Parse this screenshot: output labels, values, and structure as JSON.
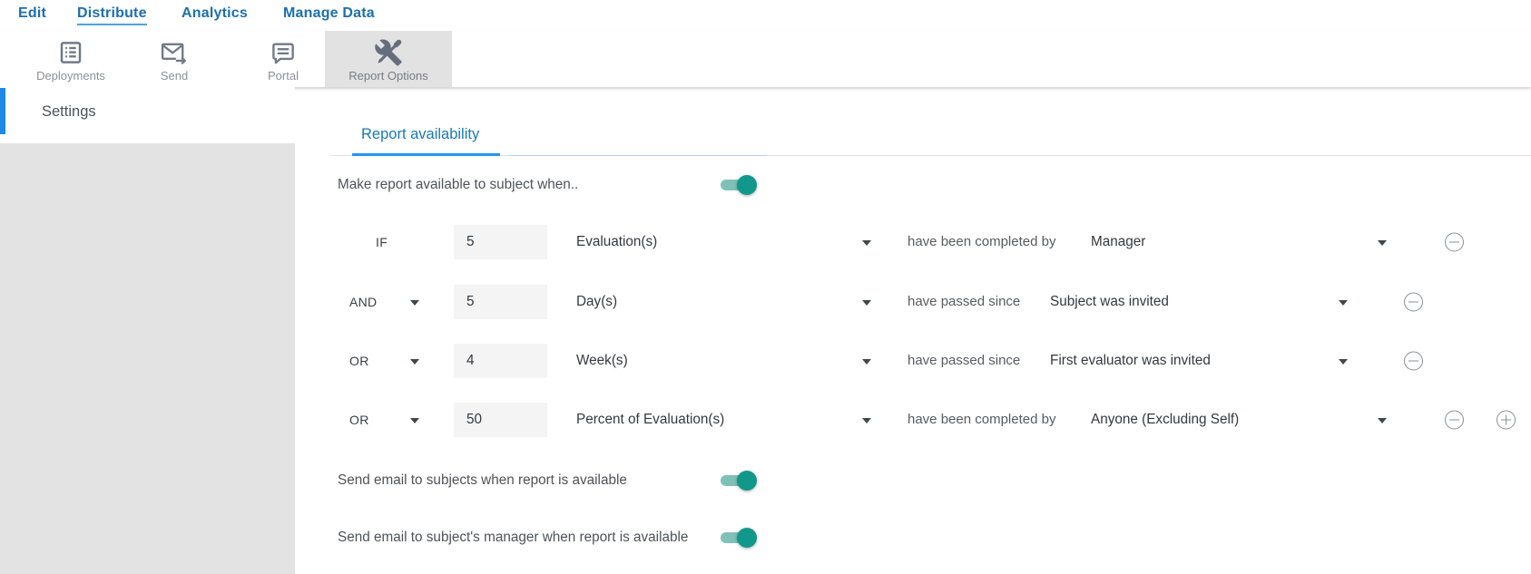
{
  "nav": {
    "items": [
      {
        "label": "Edit"
      },
      {
        "label": "Distribute",
        "active": true
      },
      {
        "label": "Analytics"
      },
      {
        "label": "Manage Data"
      }
    ]
  },
  "toolbar": {
    "items": [
      {
        "label": "Deployments",
        "icon": "list-icon"
      },
      {
        "label": "Send",
        "icon": "envelope-arrow-icon"
      },
      {
        "label": "Portal",
        "icon": "chat-bubble-icon"
      },
      {
        "label": "Report Options",
        "icon": "wrench-screwdriver-icon",
        "selected": true
      }
    ]
  },
  "sidebar": {
    "items": [
      {
        "label": "Settings",
        "active": true
      }
    ]
  },
  "main": {
    "tab": {
      "label": "Report availability",
      "active": true
    },
    "master_toggle": {
      "label": "Make report available to subject when..",
      "state": "on"
    },
    "conditions": [
      {
        "connector": "IF",
        "amount": "5",
        "unit": "Evaluation(s)",
        "verb": "have been completed by",
        "target": "Manager"
      },
      {
        "connector": "AND",
        "amount": "5",
        "unit": "Day(s)",
        "verb": "have passed since",
        "target": "Subject was invited"
      },
      {
        "connector": "OR",
        "amount": "4",
        "unit": "Week(s)",
        "verb": "have passed since",
        "target": "First evaluator was invited"
      },
      {
        "connector": "OR",
        "amount": "50",
        "unit": "Percent of Evaluation(s)",
        "verb": "have been completed by",
        "target": "Anyone (Excluding Self)"
      }
    ],
    "email_toggles": [
      {
        "label": "Send email to subjects when report is available",
        "state": "on"
      },
      {
        "label": "Send email to subject's manager when report is available",
        "state": "on"
      }
    ]
  },
  "colors": {
    "nav_blue": "#1b6fae",
    "nav_active_underline": "#4ba4dc",
    "tab_blue": "#177ab8",
    "tab_underline": "#2196f3",
    "sidebar_active_bar": "#1e88e5",
    "toggle_on_knob": "#12988a",
    "toggle_on_track": "#7fc1b8",
    "selected_tool_bg": "#e2e2e2",
    "input_bg": "#f4f4f5"
  }
}
